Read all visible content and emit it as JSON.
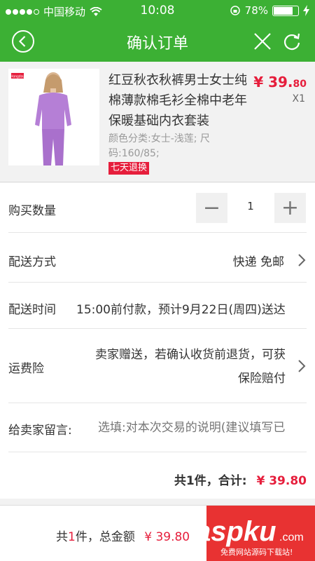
{
  "status_bar": {
    "carrier": "中国移动",
    "time": "10:08",
    "battery": "78%"
  },
  "nav": {
    "title": "确认订单"
  },
  "product": {
    "name": "红豆秋衣秋裤男士女士纯棉薄款棉毛衫全棉中老年保暖基础内衣套装",
    "spec": "颜色分类:女士-浅莲; 尺码:160/85;",
    "tag": "七天退换",
    "price_main": "¥ 39.",
    "price_cents": "80",
    "quantity_label": "X1",
    "brand_text": "Hongdou"
  },
  "quantity": {
    "label": "购买数量",
    "minus": "−",
    "value": "1",
    "plus": "+"
  },
  "delivery": {
    "label": "配送方式",
    "value": "快递 免邮"
  },
  "delivery_time": {
    "label": "配送时间",
    "value": "15:00前付款，预计9月22日(周四)送达"
  },
  "insurance": {
    "label": "运费险",
    "line1": "卖家赠送，若确认收货前退货，可获",
    "line2": "保险赔付"
  },
  "message": {
    "label": "给卖家留言:",
    "placeholder": "选填:对本次交易的说明(建议填写已"
  },
  "summary": {
    "prefix": "共1件，合计:",
    "total": "¥ 39.80"
  },
  "bottom": {
    "prefix": "共",
    "count": "1",
    "suffix": "件，总金额",
    "total": "¥ 39.80"
  },
  "watermark": {
    "main": "aspku",
    "tld": ".com",
    "sub": "免费网站源码下载站!"
  },
  "colors": {
    "accent": "#3cb034",
    "price": "#e61e3c",
    "submit": "#e83232"
  }
}
